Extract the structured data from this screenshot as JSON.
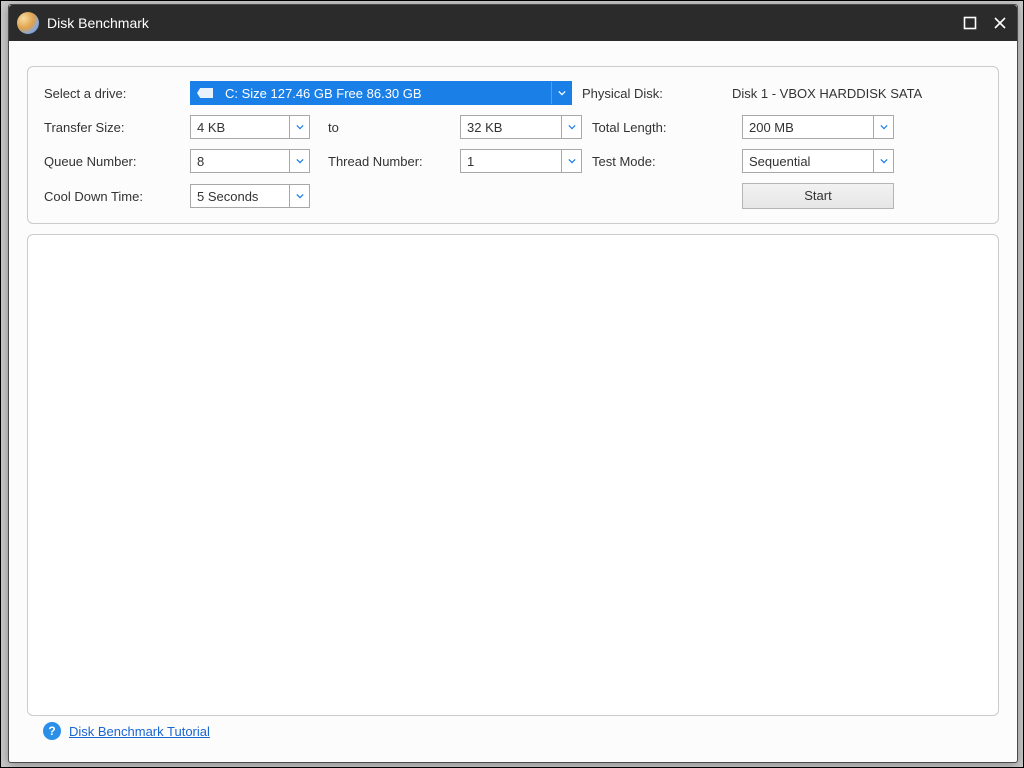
{
  "window": {
    "title": "Disk Benchmark",
    "maximize_icon": "maximize-icon",
    "close_icon": "close-icon"
  },
  "labels": {
    "select_drive": "Select a drive:",
    "physical_disk": "Physical Disk:",
    "transfer_size": "Transfer Size:",
    "to": "to",
    "total_length": "Total Length:",
    "queue_number": "Queue Number:",
    "thread_number": "Thread Number:",
    "test_mode": "Test Mode:",
    "cool_down": "Cool Down Time:"
  },
  "values": {
    "drive": "C:  Size 127.46 GB  Free 86.30 GB",
    "physical_disk": "Disk 1 - VBOX HARDDISK SATA",
    "transfer_from": "4 KB",
    "transfer_to": "32 KB",
    "total_length": "200 MB",
    "queue_number": "8",
    "thread_number": "1",
    "test_mode": "Sequential",
    "cool_down": "5 Seconds"
  },
  "buttons": {
    "start": "Start"
  },
  "footer": {
    "tutorial_link": "Disk Benchmark Tutorial"
  }
}
